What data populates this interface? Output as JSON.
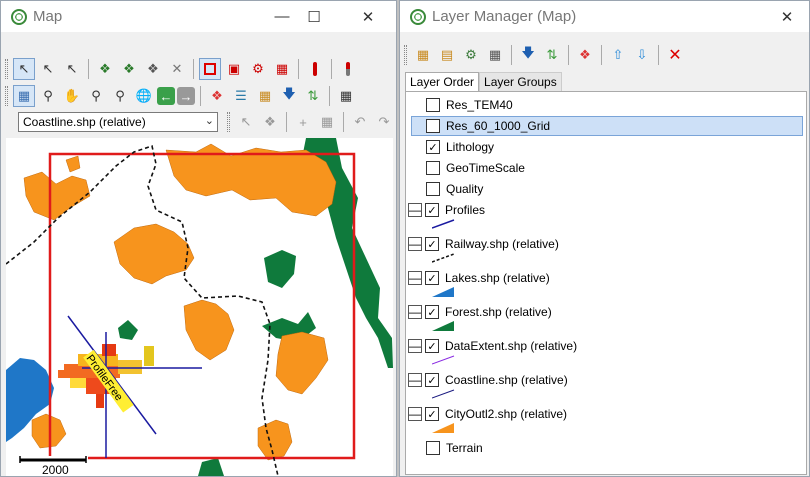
{
  "map_window": {
    "title": "Map",
    "layer_dropdown": "Coastline.shp (relative)",
    "scalebar_label": "2000",
    "profile_label": "ProfileFree",
    "toolbar1_icons": [
      "select-arrow-icon",
      "select-node-icon",
      "select-multi-icon",
      "map-grab-icon",
      "map-grab-2-icon",
      "map-grab-3-icon",
      "delete-icon",
      "rect-red-icon",
      "zoom-box-icon",
      "gear-red-icon",
      "polygon-red-icon",
      "red-bar-icon",
      "pencil-icon"
    ],
    "toolbar2_icons": [
      "layer-view-icon",
      "zoom-window-icon",
      "pan-hand-icon",
      "zoom-in-icon",
      "zoom-out-icon",
      "globe-icon",
      "back-icon",
      "forward-icon",
      "layer-add-icon",
      "layers-icon",
      "layer-props-icon",
      "download-icon",
      "refresh-icon",
      "grid-icon"
    ],
    "toolbar3_icons": [
      "edit-cursor-icon",
      "node-edit-icon",
      "add-icon",
      "table-icon",
      "undo-icon",
      "redo-icon",
      "shape-icon"
    ]
  },
  "layer_manager": {
    "title": "Layer Manager (Map)",
    "tabs": [
      "Layer Order",
      "Layer Groups"
    ],
    "toolbar_icons": [
      "add-layer-icon",
      "layer-properties-icon",
      "layer-style-icon",
      "attribute-table-icon",
      "download-icon",
      "refresh-icon",
      "layer-color-icon",
      "move-up-icon",
      "move-down-icon",
      "remove-layer-icon"
    ],
    "layers": [
      {
        "name": "Res_TEM40",
        "checked": false,
        "collapsible": false
      },
      {
        "name": "Res_60_1000_Grid",
        "checked": false,
        "collapsible": false,
        "selected": true
      },
      {
        "name": "Lithology",
        "checked": true,
        "collapsible": false
      },
      {
        "name": "GeoTimeScale",
        "checked": false,
        "collapsible": false
      },
      {
        "name": "Quality",
        "checked": false,
        "collapsible": false
      },
      {
        "name": "Profiles",
        "checked": true,
        "collapsible": true,
        "legend": "line-blue"
      },
      {
        "name": "Railway.shp (relative)",
        "checked": true,
        "collapsible": true,
        "legend": "line-dashed"
      },
      {
        "name": "Lakes.shp (relative)",
        "checked": true,
        "collapsible": true,
        "legend": "wedge-blue"
      },
      {
        "name": "Forest.shp (relative)",
        "checked": true,
        "collapsible": true,
        "legend": "wedge-green"
      },
      {
        "name": "DataExtent.shp (relative)",
        "checked": true,
        "collapsible": true,
        "legend": "line-purple"
      },
      {
        "name": "Coastline.shp (relative)",
        "checked": true,
        "collapsible": true,
        "legend": "line-navy"
      },
      {
        "name": "CityOutl2.shp (relative)",
        "checked": true,
        "collapsible": true,
        "legend": "wedge-orange"
      },
      {
        "name": "Terrain",
        "checked": false,
        "collapsible": false
      }
    ]
  },
  "colors": {
    "city": "#f7941d",
    "forest": "#0f7a3c",
    "lake": "#1f77c8",
    "extent": "#e01b1b",
    "profile": "#1a1aa0",
    "highlight": "#cde0f7"
  }
}
